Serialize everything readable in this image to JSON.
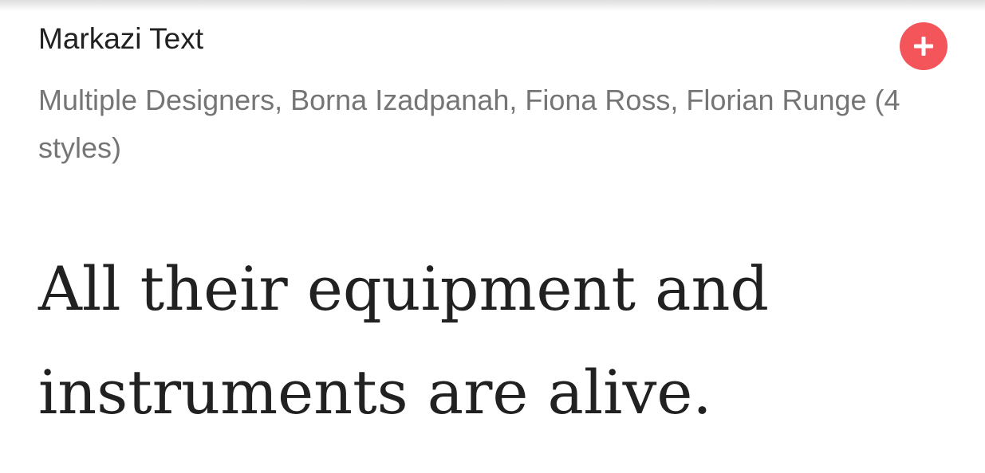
{
  "font_card": {
    "family_name": "Markazi Text",
    "designers": "Multiple Designers, Borna Izadpanah, Fiona Ross, Florian Runge (4 styles)",
    "add_icon": "plus-icon",
    "accent_color": "#f4555a",
    "sample_text": "All their equipment and instruments are alive."
  }
}
